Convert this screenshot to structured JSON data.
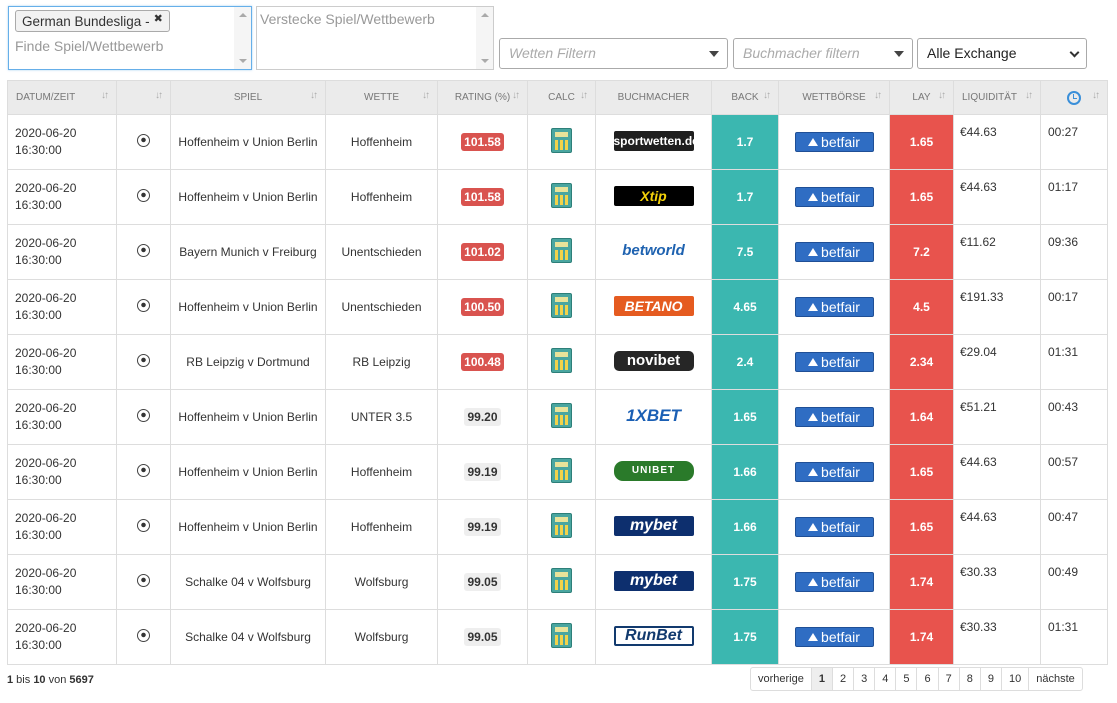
{
  "filters": {
    "competition_tag": "German Bundesliga -",
    "competition_placeholder": "Finde Spiel/Wettbewerb",
    "hide_placeholder": "Verstecke Spiel/Wettbewerb",
    "bet_filter_placeholder": "Wetten Filtern",
    "bookmaker_filter_placeholder": "Buchmacher filtern",
    "exchange_select_value": "Alle Exchange"
  },
  "table": {
    "headers": [
      "DATUM/ZEIT",
      "",
      "SPIEL",
      "WETTE",
      "RATING (%)",
      "CALC",
      "BUCHMACHER",
      "BACK",
      "WETTBÖRSE",
      "LAY",
      "LIQUIDITÄT",
      ""
    ],
    "rows": [
      {
        "date": "2020-06-20",
        "time": "16:30:00",
        "game": "Hoffenheim v Union Berlin",
        "bet": "Hoffenheim",
        "rating": "101.58",
        "hot": true,
        "bookmaker": "sportwetten.de",
        "bm_style": "bm-dark",
        "back": "1.7",
        "exchange": "betfair",
        "lay": "1.65",
        "liquidity": "€44.63",
        "ago": "00:27"
      },
      {
        "date": "2020-06-20",
        "time": "16:30:00",
        "game": "Hoffenheim v Union Berlin",
        "bet": "Hoffenheim",
        "rating": "101.58",
        "hot": true,
        "bookmaker": "Xtip",
        "bm_style": "bm-xtip",
        "back": "1.7",
        "exchange": "betfair",
        "lay": "1.65",
        "liquidity": "€44.63",
        "ago": "01:17"
      },
      {
        "date": "2020-06-20",
        "time": "16:30:00",
        "game": "Bayern Munich v Freiburg",
        "bet": "Unentschieden",
        "rating": "101.02",
        "hot": true,
        "bookmaker": "betworld",
        "bm_style": "bm-white-blue",
        "back": "7.5",
        "exchange": "betfair",
        "lay": "7.2",
        "liquidity": "€11.62",
        "ago": "09:36"
      },
      {
        "date": "2020-06-20",
        "time": "16:30:00",
        "game": "Hoffenheim v Union Berlin",
        "bet": "Unentschieden",
        "rating": "100.50",
        "hot": true,
        "bookmaker": "BETANO",
        "bm_style": "bm-betano",
        "back": "4.65",
        "exchange": "betfair",
        "lay": "4.5",
        "liquidity": "€191.33",
        "ago": "00:17"
      },
      {
        "date": "2020-06-20",
        "time": "16:30:00",
        "game": "RB Leipzig v Dortmund",
        "bet": "RB Leipzig",
        "rating": "100.48",
        "hot": true,
        "bookmaker": "novibet",
        "bm_style": "bm-novibet",
        "back": "2.4",
        "exchange": "betfair",
        "lay": "2.34",
        "liquidity": "€29.04",
        "ago": "01:31"
      },
      {
        "date": "2020-06-20",
        "time": "16:30:00",
        "game": "Hoffenheim v Union Berlin",
        "bet": "UNTER 3.5",
        "rating": "99.20",
        "hot": false,
        "bookmaker": "1XBET",
        "bm_style": "bm-1x",
        "back": "1.65",
        "exchange": "betfair",
        "lay": "1.64",
        "liquidity": "€51.21",
        "ago": "00:43"
      },
      {
        "date": "2020-06-20",
        "time": "16:30:00",
        "game": "Hoffenheim v Union Berlin",
        "bet": "Hoffenheim",
        "rating": "99.19",
        "hot": false,
        "bookmaker": "UNIBET",
        "bm_style": "bm-unibet",
        "back": "1.66",
        "exchange": "betfair",
        "lay": "1.65",
        "liquidity": "€44.63",
        "ago": "00:57"
      },
      {
        "date": "2020-06-20",
        "time": "16:30:00",
        "game": "Hoffenheim v Union Berlin",
        "bet": "Hoffenheim",
        "rating": "99.19",
        "hot": false,
        "bookmaker": "mybet",
        "bm_style": "bm-mybet",
        "back": "1.66",
        "exchange": "betfair",
        "lay": "1.65",
        "liquidity": "€44.63",
        "ago": "00:47"
      },
      {
        "date": "2020-06-20",
        "time": "16:30:00",
        "game": "Schalke 04 v Wolfsburg",
        "bet": "Wolfsburg",
        "rating": "99.05",
        "hot": false,
        "bookmaker": "mybet",
        "bm_style": "bm-mybet",
        "back": "1.75",
        "exchange": "betfair",
        "lay": "1.74",
        "liquidity": "€30.33",
        "ago": "00:49"
      },
      {
        "date": "2020-06-20",
        "time": "16:30:00",
        "game": "Schalke 04 v Wolfsburg",
        "bet": "Wolfsburg",
        "rating": "99.05",
        "hot": false,
        "bookmaker": "RunBet",
        "bm_style": "bm-runbet",
        "back": "1.75",
        "exchange": "betfair",
        "lay": "1.74",
        "liquidity": "€30.33",
        "ago": "01:31"
      }
    ]
  },
  "info": {
    "from": "1",
    "mid1": " bis ",
    "to": "10",
    "mid2": " von ",
    "total": "5697"
  },
  "pager": {
    "prev": "vorherige",
    "pages": [
      "1",
      "2",
      "3",
      "4",
      "5",
      "6",
      "7",
      "8",
      "9",
      "10"
    ],
    "next": "nächste",
    "current": "1"
  },
  "colors": {
    "back": "#3bb7b0",
    "lay": "#e8534d",
    "rating_hot": "#d9534f",
    "betfair": "#2f6dc3"
  }
}
